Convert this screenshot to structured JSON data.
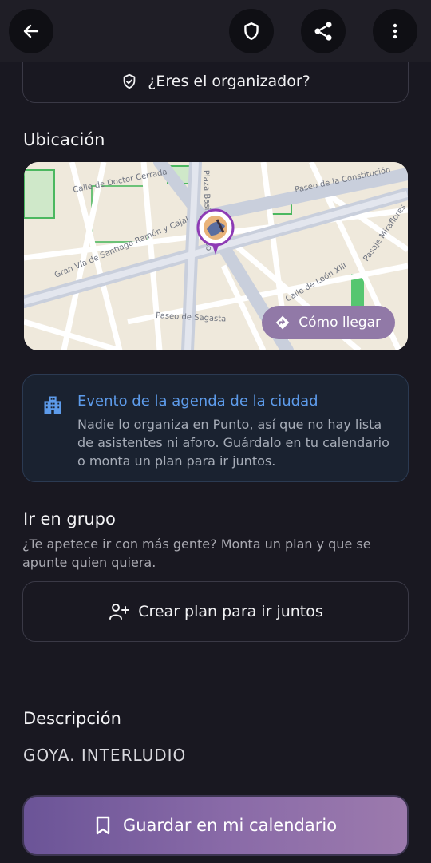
{
  "header": {
    "back_icon": "arrow-left-icon",
    "shield_icon": "shield-icon",
    "share_icon": "share-icon",
    "more_icon": "more-vertical-icon"
  },
  "organizer_card": {
    "label": "¿Eres el organizador?",
    "icon": "shield-check-icon"
  },
  "location": {
    "title": "Ubicación",
    "map_labels": {
      "street1": "Calle de Doctor Cerrada",
      "street2": "Gran Vía de Santiago Ramón y Cajal",
      "street3": "Plaza Basilio Paraíso",
      "street4": "Paseo de la Constitución",
      "street5": "Pasaje Miraflores",
      "street6": "Calle de León XIII",
      "street7": "Paseo de Sagasta"
    },
    "directions_label": "Cómo llegar"
  },
  "city_event": {
    "title": "Evento de la agenda de la ciudad",
    "body": "Nadie lo organiza en Punto, así que no hay lista de asistentes ni aforo. Guárdalo en tu calendario o monta un plan para ir juntos.",
    "icon": "building-icon"
  },
  "group": {
    "title": "Ir en grupo",
    "subtitle": "¿Te apetece ir con más gente? Monta un plan y que se apunte quien quiera.",
    "button_label": "Crear plan para ir juntos"
  },
  "description": {
    "title": "Descripción",
    "text": "GOYA. INTERLUDIO"
  },
  "save_button": {
    "label": "Guardar en mi calendario"
  },
  "colors": {
    "background": "#191821",
    "accent_purple": "#8a6ba8",
    "info_blue": "#5d9bea",
    "pin_purple": "#8e3bb5"
  }
}
